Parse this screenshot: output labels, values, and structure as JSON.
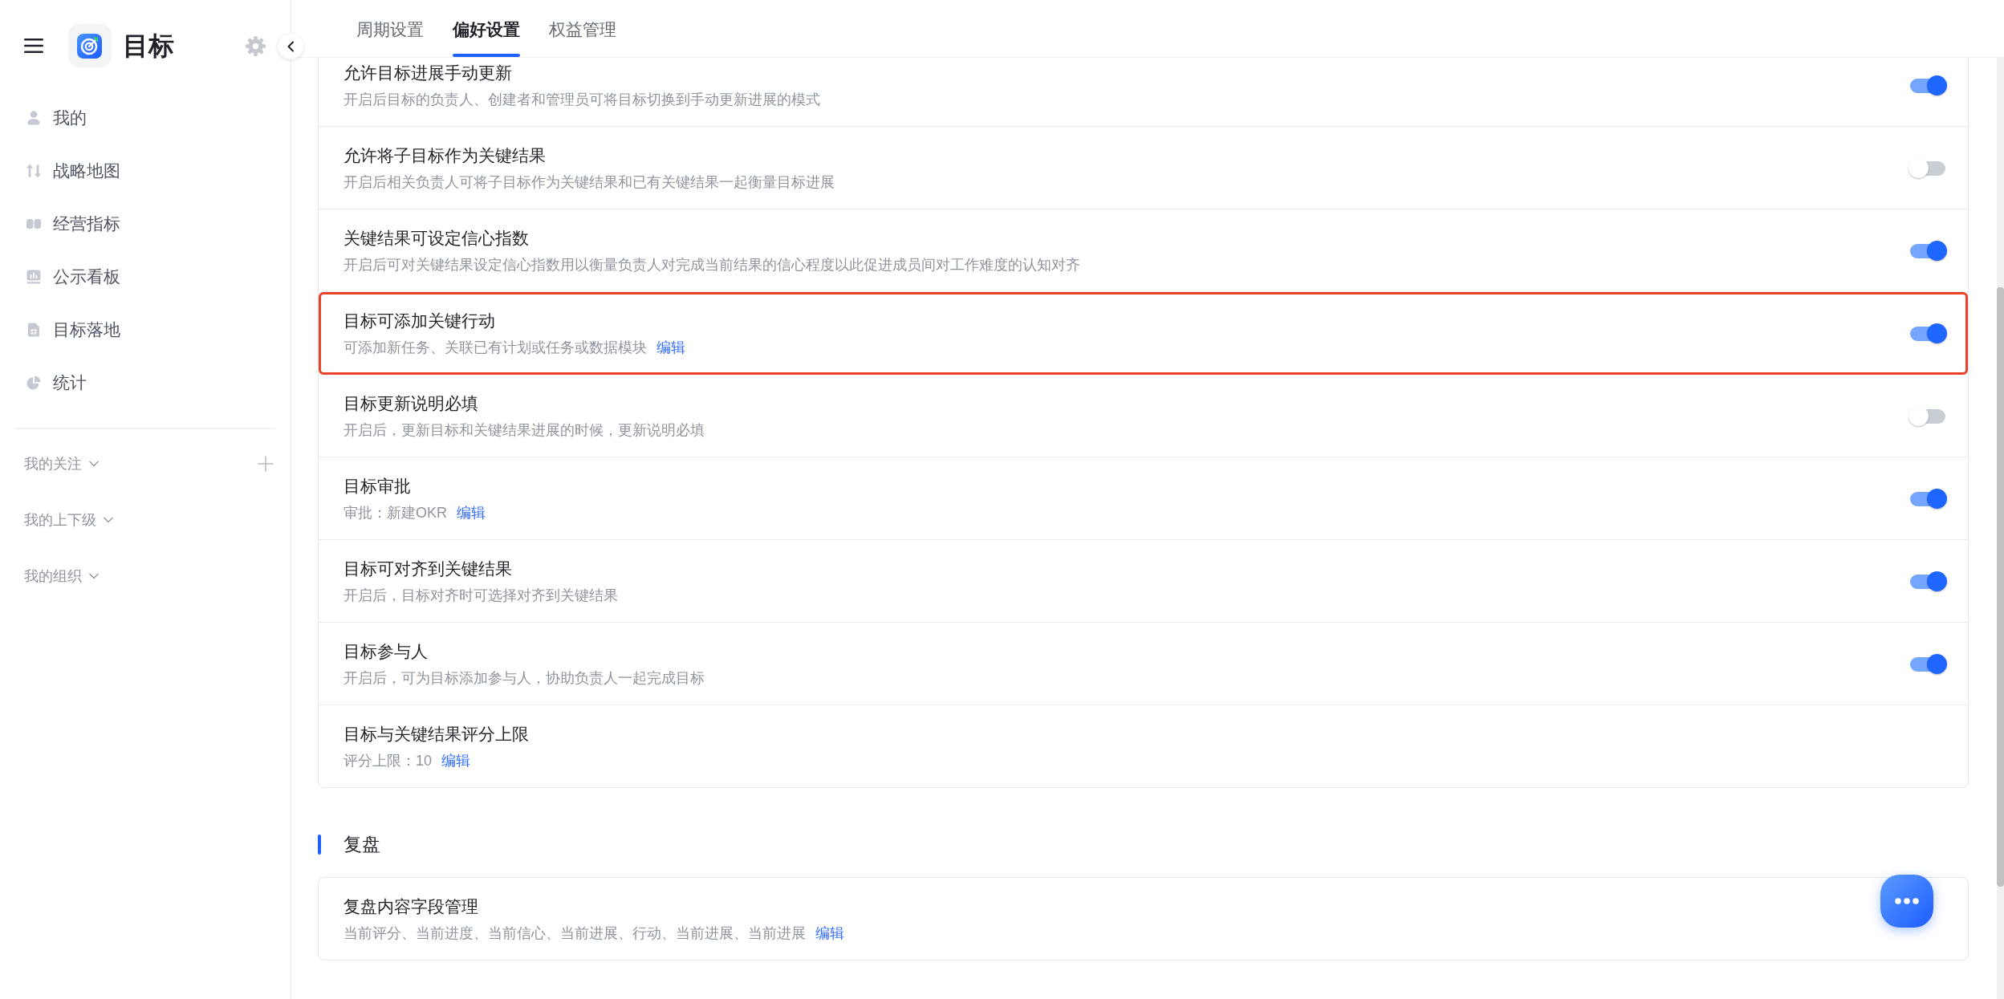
{
  "sidebar": {
    "title": "目标",
    "nav": [
      {
        "label": "我的",
        "selected": false
      },
      {
        "label": "战略地图",
        "selected": false
      },
      {
        "label": "经营指标",
        "selected": false
      },
      {
        "label": "公示看板",
        "selected": false
      },
      {
        "label": "目标落地",
        "selected": false
      },
      {
        "label": "统计",
        "selected": false
      }
    ],
    "groups": [
      {
        "label": "我的关注",
        "add_button": true
      },
      {
        "label": "我的上下级",
        "add_button": false
      },
      {
        "label": "我的组织",
        "add_button": false
      }
    ]
  },
  "tabs": [
    {
      "label": "周期设置",
      "selected": false
    },
    {
      "label": "偏好设置",
      "selected": true
    },
    {
      "label": "权益管理",
      "selected": false
    }
  ],
  "settings": [
    {
      "title": "允许目标进展手动更新",
      "description": "开启后目标的负责人、创建者和管理员可将目标切换到手动更新进展的模式",
      "toggle": {
        "on": true
      },
      "highlighted": false
    },
    {
      "title": "允许将子目标作为关键结果",
      "description": "开启后相关负责人可将子目标作为关键结果和已有关键结果一起衡量目标进展",
      "toggle": {
        "on": false
      },
      "highlighted": false
    },
    {
      "title": "关键结果可设定信心指数",
      "description": "开启后可对关键结果设定信心指数用以衡量负责人对完成当前结果的信心程度以此促进成员间对工作难度的认知对齐",
      "toggle": {
        "on": true
      },
      "highlighted": false
    },
    {
      "title": "目标可添加关键行动",
      "description": "可添加新任务、关联已有计划或任务或数据模块",
      "link": "编辑",
      "toggle": {
        "on": true
      },
      "highlighted": true
    },
    {
      "title": "目标更新说明必填",
      "description": "开启后，更新目标和关键结果进展的时候，更新说明必填",
      "toggle": {
        "on": false
      },
      "highlighted": false
    },
    {
      "title": "目标审批",
      "description": "审批：新建OKR",
      "link": "编辑",
      "toggle": {
        "on": true
      },
      "highlighted": false
    },
    {
      "title": "目标可对齐到关键结果",
      "description": "开启后，目标对齐时可选择对齐到关键结果",
      "toggle": {
        "on": true
      },
      "highlighted": false
    },
    {
      "title": "目标参与人",
      "description": "开启后，可为目标添加参与人，协助负责人一起完成目标",
      "toggle": {
        "on": true
      },
      "highlighted": false
    },
    {
      "title": "目标与关键结果评分上限",
      "description": "评分上限：10",
      "link": "编辑",
      "highlighted": false
    }
  ],
  "sections": [
    {
      "title": "复盘",
      "items": [
        {
          "title": "复盘内容字段管理",
          "description": "当前评分、当前进度、当前信心、当前进展、行动、当前进展、当前进展",
          "link": "编辑"
        }
      ]
    }
  ]
}
